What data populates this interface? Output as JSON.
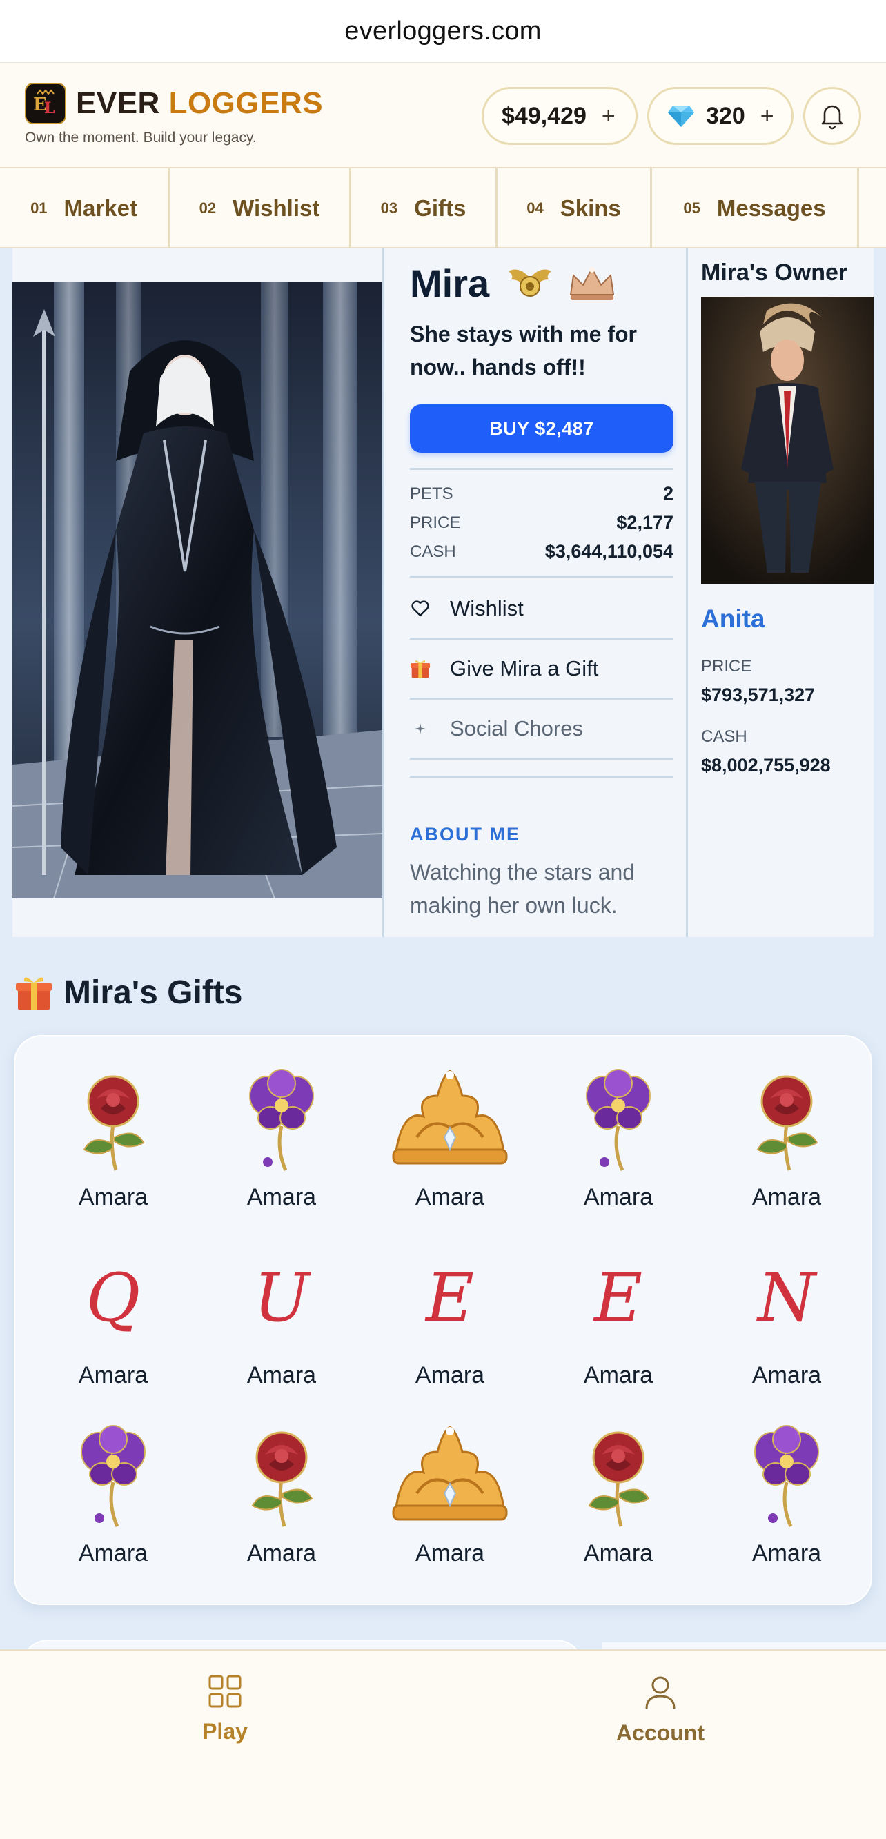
{
  "browser": {
    "url": "everloggers.com"
  },
  "header": {
    "brand_word1": "EVER",
    "brand_word2": "LOGGERS",
    "tagline": "Own the moment. Build your legacy.",
    "cash": "$49,429",
    "cash_plus": "+",
    "gems": "320",
    "gems_plus": "+"
  },
  "nav_tabs": [
    {
      "num": "01",
      "label": "Market"
    },
    {
      "num": "02",
      "label": "Wishlist"
    },
    {
      "num": "03",
      "label": "Gifts"
    },
    {
      "num": "04",
      "label": "Skins"
    },
    {
      "num": "05",
      "label": "Messages"
    }
  ],
  "profile": {
    "name": "Mira",
    "quote": "She stays with me for now.. hands off!!",
    "buy_label": "BUY $2,487",
    "stats": [
      {
        "key": "PETS",
        "value": "2"
      },
      {
        "key": "PRICE",
        "value": "$2,177"
      },
      {
        "key": "CASH",
        "value": "$3,644,110,054"
      }
    ],
    "actions": [
      {
        "label": "Wishlist",
        "icon": "heart-icon"
      },
      {
        "label": "Give Mira a Gift",
        "icon": "gift-icon"
      },
      {
        "label": "Social Chores",
        "icon": "sparkle-icon"
      }
    ],
    "about_heading": "ABOUT ME",
    "about_text": "Watching the stars and making her own luck."
  },
  "owner": {
    "title": "Mira's Owner",
    "name": "Anita",
    "price_label": "PRICE",
    "price": "$793,571,327",
    "cash_label": "CASH",
    "cash": "$8,002,755,928"
  },
  "gifts": {
    "title": "Mira's Gifts",
    "items": [
      {
        "kind": "rose",
        "label": "Amara"
      },
      {
        "kind": "orchid",
        "label": "Amara"
      },
      {
        "kind": "crown",
        "label": "Amara"
      },
      {
        "kind": "orchid",
        "label": "Amara"
      },
      {
        "kind": "rose",
        "label": "Amara"
      },
      {
        "kind": "letter",
        "letter": "Q",
        "label": "Amara"
      },
      {
        "kind": "letter",
        "letter": "U",
        "label": "Amara"
      },
      {
        "kind": "letter",
        "letter": "E",
        "label": "Amara"
      },
      {
        "kind": "letter",
        "letter": "E",
        "label": "Amara"
      },
      {
        "kind": "letter",
        "letter": "N",
        "label": "Amara"
      },
      {
        "kind": "orchid",
        "label": "Amara"
      },
      {
        "kind": "rose",
        "label": "Amara"
      },
      {
        "kind": "crown",
        "label": "Amara"
      },
      {
        "kind": "rose",
        "label": "Amara"
      },
      {
        "kind": "orchid",
        "label": "Amara"
      }
    ]
  },
  "bottom_nav": [
    {
      "label": "Play",
      "icon": "grid-icon"
    },
    {
      "label": "Account",
      "icon": "user-icon"
    }
  ],
  "colors": {
    "accent_blue": "#1f5ef8",
    "link_blue": "#2c6fd6",
    "brand_gold": "#c97b12",
    "tab_brown": "#6e5121"
  }
}
